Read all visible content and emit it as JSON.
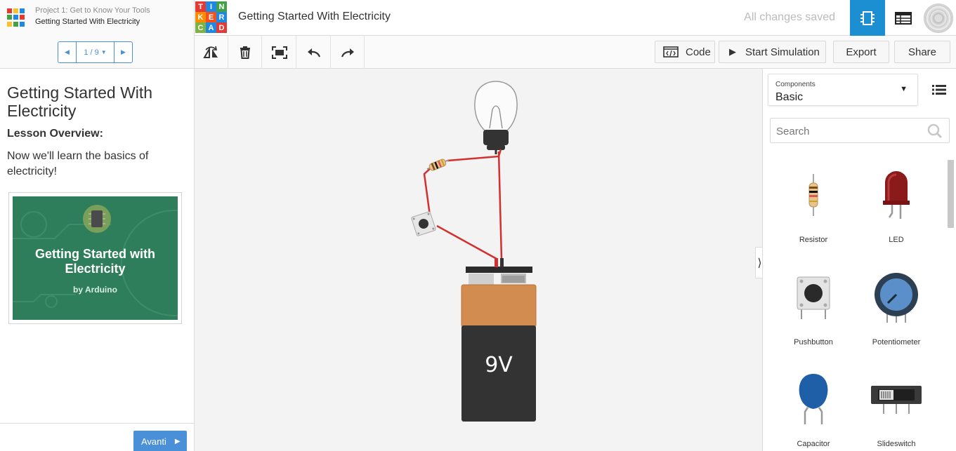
{
  "header": {
    "project_subtitle": "Project 1: Get to Know Your Tools",
    "project_title": "Getting Started With Electricity",
    "logo_letters": [
      "T",
      "I",
      "N",
      "K",
      "E",
      "R",
      "C",
      "A",
      "D"
    ],
    "design_title": "Getting Started With Electricity",
    "save_status": "All changes saved"
  },
  "toolbar": {
    "code_label": "Code",
    "simulate_label": "Start Simulation",
    "export_label": "Export",
    "share_label": "Share"
  },
  "lesson": {
    "pager_label": "1 / 9",
    "title": "Getting Started With Electricity",
    "overview_heading": "Lesson Overview:",
    "text": "Now we'll learn the basics of electricity!",
    "thumbnail_title": "Getting Started with Electricity",
    "thumbnail_byline": "by Arduino",
    "next_label": "Avanti"
  },
  "circuit": {
    "battery_label": "9V"
  },
  "components_panel": {
    "select_label": "Components",
    "select_value": "Basic",
    "search_placeholder": "Search",
    "parts": [
      {
        "name": "Resistor",
        "icon": "resistor-icon"
      },
      {
        "name": "LED",
        "icon": "led-icon"
      },
      {
        "name": "Pushbutton",
        "icon": "pushbutton-icon"
      },
      {
        "name": "Potentiometer",
        "icon": "potentiometer-icon"
      },
      {
        "name": "Capacitor",
        "icon": "capacitor-icon"
      },
      {
        "name": "Slideswitch",
        "icon": "slideswitch-icon"
      }
    ]
  },
  "colors": {
    "accent_blue": "#1b8fd1",
    "pager_blue": "#4a90d9",
    "wire_red": "#d32f2f",
    "battery_top": "#d38c4f",
    "battery_body": "#333333",
    "thumbnail_green": "#2e7d5b",
    "logo": [
      "#e53935",
      "#1e88e5",
      "#43a047",
      "#fb8c00",
      "#f4511e",
      "#1e88e5",
      "#7cb342",
      "#1e88e5",
      "#e53935"
    ]
  }
}
